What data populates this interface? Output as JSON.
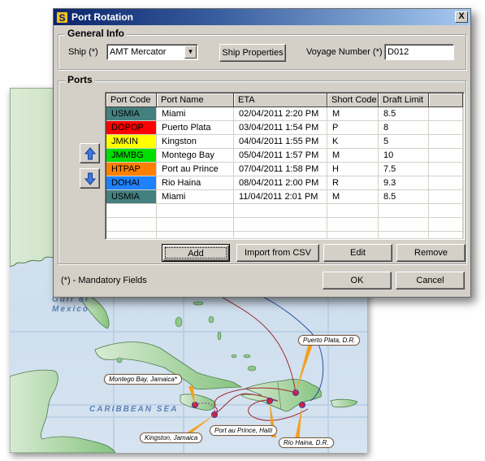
{
  "window": {
    "title": "Port Rotation",
    "close_label": "X"
  },
  "general_info": {
    "legend": "General Info",
    "ship_label": "Ship (*)",
    "ship_value": "AMT Mercator",
    "ship_properties_label": "Ship Properties",
    "voyage_label": "Voyage Number (*)",
    "voyage_value": "D012"
  },
  "ports": {
    "legend": "Ports",
    "columns": [
      "Port Code",
      "Port Name",
      "ETA",
      "Short Code",
      "Draft Limit",
      ""
    ],
    "rows": [
      {
        "code": "USMIA",
        "color": "#458080",
        "name": "Miami",
        "eta": "02/04/2011 2:20 PM",
        "short": "M",
        "draft": "8.5"
      },
      {
        "code": "DOPOP",
        "color": "#ff0000",
        "name": "Puerto Plata",
        "eta": "03/04/2011 1:54 PM",
        "short": "P",
        "draft": "8"
      },
      {
        "code": "JMKIN",
        "color": "#ffff00",
        "name": "Kingston",
        "eta": "04/04/2011 1:55 PM",
        "short": "K",
        "draft": "5"
      },
      {
        "code": "JMMBG",
        "color": "#00e000",
        "name": "Montego Bay",
        "eta": "05/04/2011 1:57 PM",
        "short": "M",
        "draft": "10"
      },
      {
        "code": "HTPAP",
        "color": "#ff8000",
        "name": "Port au Prince",
        "eta": "07/04/2011 1:58 PM",
        "short": "H",
        "draft": "7.5"
      },
      {
        "code": "DOHAI",
        "color": "#1e82ff",
        "name": "Rio Haina",
        "eta": "08/04/2011 2:00 PM",
        "short": "R",
        "draft": "9.3"
      },
      {
        "code": "USMIA",
        "color": "#458080",
        "name": "Miami",
        "eta": "11/04/2011 2:01 PM",
        "short": "M",
        "draft": "8.5"
      }
    ],
    "empty_rows": 3,
    "move_up_icon": "arrow-up-icon",
    "move_down_icon": "arrow-down-icon",
    "add_label": "Add",
    "import_label": "Import from CSV",
    "edit_label": "Edit",
    "remove_label": "Remove"
  },
  "footer": {
    "mandatory_note": "(*) - Mandatory Fields",
    "ok_label": "OK",
    "cancel_label": "Cancel"
  },
  "map": {
    "labels": {
      "gulf": "Gulf of\nMexico",
      "sea": "CARIBBEAN SEA"
    },
    "callouts": {
      "puerto_plata": "Puerto Plata, D.R.",
      "montego_bay": "Montego Bay, Jamaica*",
      "kingston": "Kingston, Jamaica",
      "port_au_prince": "Port au Prince, Haiti",
      "rio_haina": "Rio Haina, D.R."
    },
    "colors": {
      "land": "#8fc98a",
      "sea": "#d6e3f0",
      "route_red": "#a0282f",
      "route_blue": "#2a4fa8",
      "port_dot": "#d42040",
      "pointer": "#f4a020"
    }
  }
}
